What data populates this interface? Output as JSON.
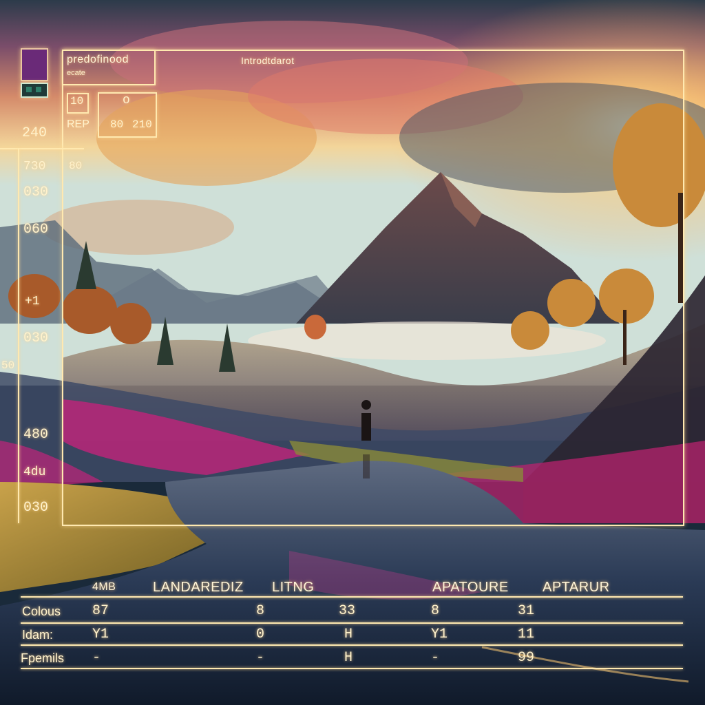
{
  "colors": {
    "hud": "#ffe9b0",
    "swatch": "#6a2a78",
    "swatch_small": "#2f7f6a"
  },
  "icons": [
    "color-swatch-icon",
    "mini-swatch-icon"
  ],
  "panel": {
    "title": "predofinood",
    "subtitle": "ecate",
    "header_right": "Introdtdarot",
    "box_label": "10",
    "dot_label": "o",
    "rep_label": "REP",
    "rep_value1": "80",
    "rep_value2": "210"
  },
  "scale": {
    "labels": [
      "240",
      "730",
      "030",
      "060",
      "+1",
      "030",
      "50",
      "480",
      "4du",
      "030"
    ],
    "extra_label": "80"
  },
  "table": {
    "headers": [
      "4MB",
      "LANDAREDIZ",
      "LITNG",
      "APATOURE",
      "APTARUR"
    ],
    "rows": [
      {
        "label": "Colous",
        "values": [
          "87",
          "8",
          "33",
          "8",
          "31"
        ]
      },
      {
        "label": "Idam:",
        "values": [
          "Y1",
          "0",
          "H",
          "Y1",
          "11"
        ]
      },
      {
        "label": "Fpemils",
        "values": [
          "-",
          "-",
          "H",
          "-",
          "99"
        ]
      }
    ]
  }
}
